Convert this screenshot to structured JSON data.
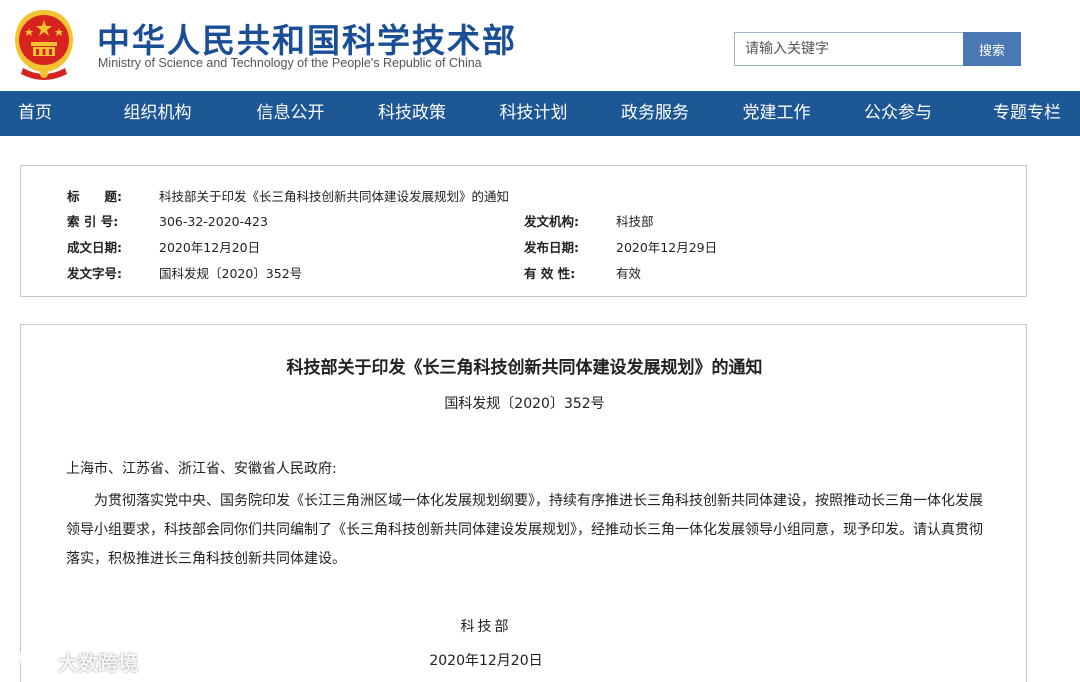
{
  "header": {
    "title": "中华人民共和国科学技术部",
    "subtitle": "Ministry of Science and Technology of the People's Republic of China",
    "emblem_icon": "national-emblem-icon"
  },
  "search": {
    "placeholder": "请输入关键字",
    "button_label": "搜索"
  },
  "nav": {
    "items": [
      {
        "label": "首页"
      },
      {
        "label": "组织机构"
      },
      {
        "label": "信息公开"
      },
      {
        "label": "科技政策"
      },
      {
        "label": "科技计划"
      },
      {
        "label": "政务服务"
      },
      {
        "label": "党建工作"
      },
      {
        "label": "公众参与"
      },
      {
        "label": "专题专栏"
      }
    ]
  },
  "info": {
    "title_label": "标　　题:",
    "title_value": "科技部关于印发《长三角科技创新共同体建设发展规划》的通知",
    "index_label": "索 引 号:",
    "index_value": "306-32-2020-423",
    "issuer_label": "发文机构:",
    "issuer_value": "科技部",
    "created_label": "成文日期:",
    "created_value": "2020年12月20日",
    "published_label": "发布日期:",
    "published_value": "2020年12月29日",
    "docno_label": "发文字号:",
    "docno_value": "国科发规〔2020〕352号",
    "validity_label": "有 效 性:",
    "validity_value": "有效"
  },
  "document": {
    "title": "科技部关于印发《长三角科技创新共同体建设发展规划》的通知",
    "number": "国科发规〔2020〕352号",
    "recipient": "上海市、江苏省、浙江省、安徽省人民政府:",
    "body": "为贯彻落实党中央、国务院印发《长江三角洲区域一体化发展规划纲要》，持续有序推进长三角科技创新共同体建设，按照推动长三角一体化发展领导小组要求，科技部会同你们共同编制了《长三角科技创新共同体建设发展规划》，经推动长三角一体化发展领导小组同意，现予印发。请认真贯彻落实，积极推进长三角科技创新共同体建设。",
    "signer": "科技部",
    "date": "2020年12月20日"
  },
  "watermark": {
    "text": "大数跨境"
  },
  "colors": {
    "brand_blue": "#1a4e96",
    "nav_blue": "#1d5796",
    "button_blue": "#4a78b2",
    "emblem_red": "#d7231e",
    "emblem_gold": "#f2c230"
  }
}
